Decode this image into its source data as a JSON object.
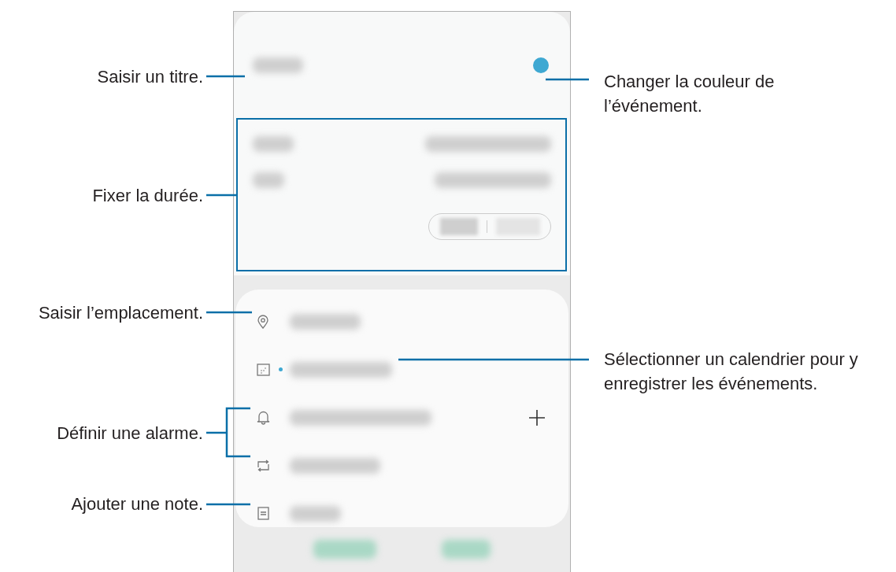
{
  "left_callouts": [
    "Saisir un titre.",
    "Fixer la durée.",
    "Saisir l’emplacement.",
    "Définir une alarme.",
    "Ajouter une note."
  ],
  "right_callouts": [
    "Changer la couleur de l’événement.",
    "Sélectionner un calendrier pour y enregistrer les événements."
  ],
  "event": {
    "color": "#3ea8d2"
  },
  "rows": [
    {
      "kind": "location"
    },
    {
      "kind": "calendar"
    },
    {
      "kind": "alarm"
    },
    {
      "kind": "repeat"
    },
    {
      "kind": "note"
    }
  ]
}
